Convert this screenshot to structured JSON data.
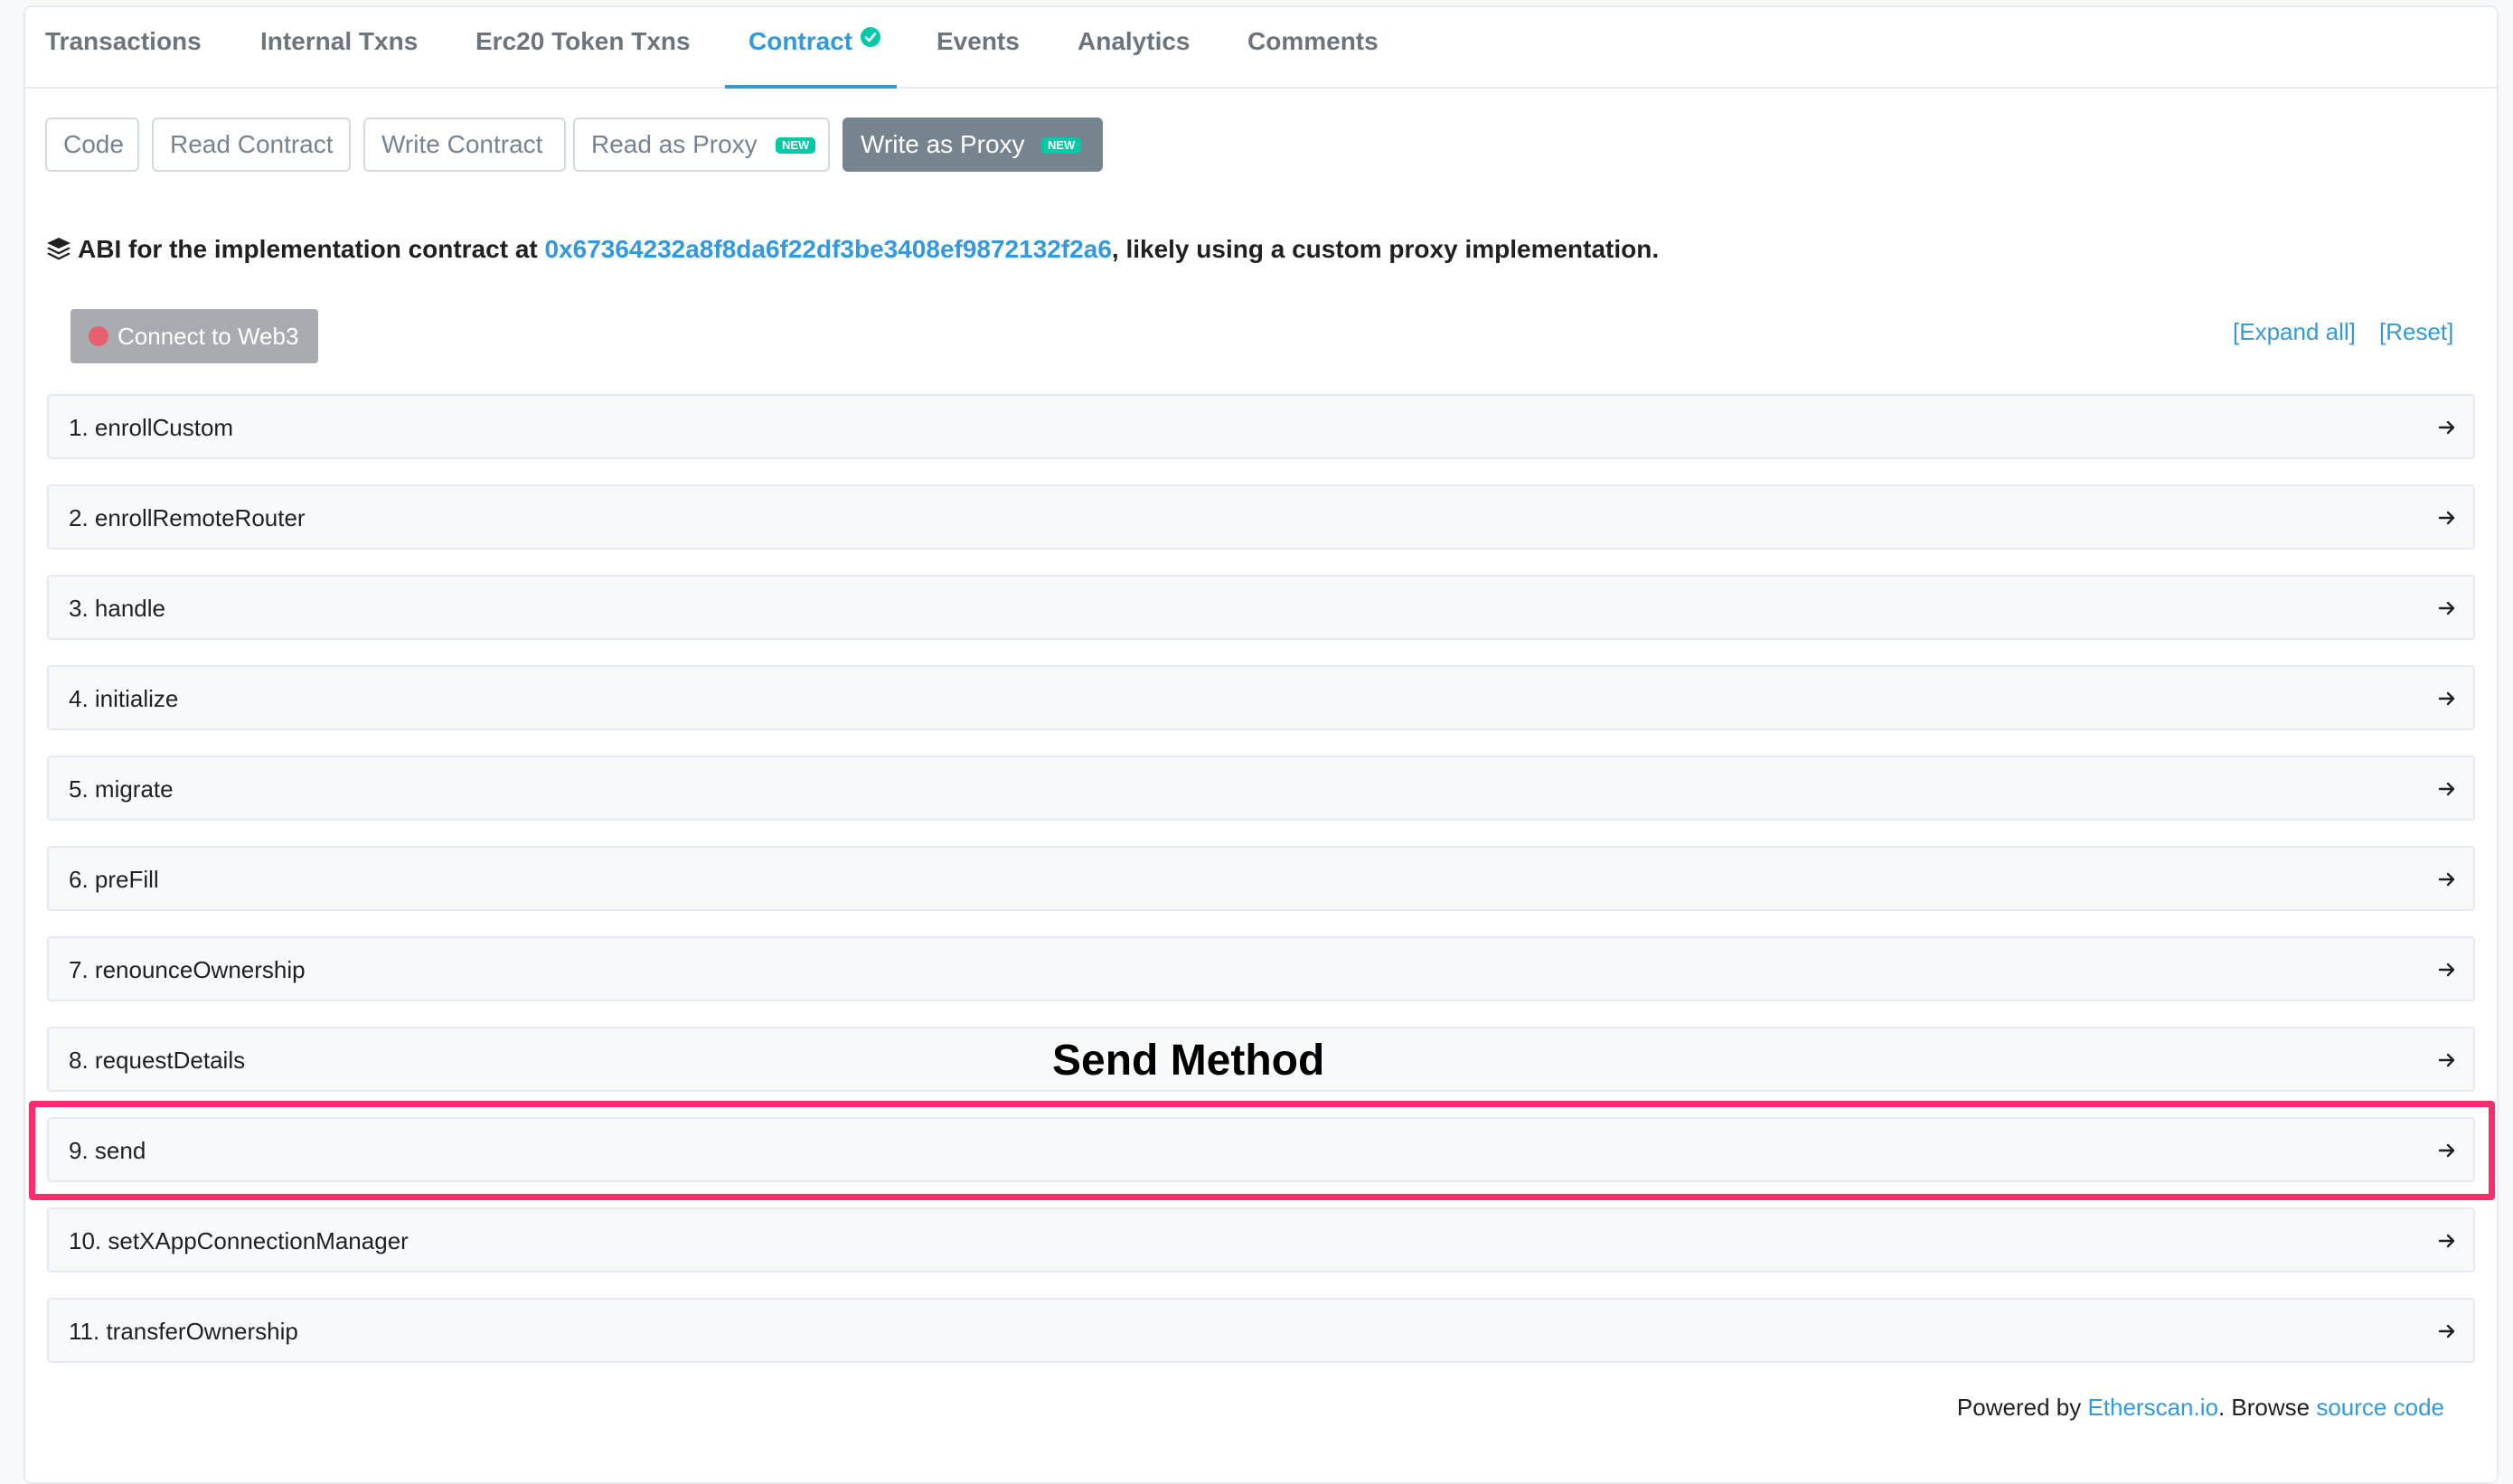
{
  "tabs": [
    {
      "label": "Transactions"
    },
    {
      "label": "Internal Txns"
    },
    {
      "label": "Erc20 Token Txns"
    },
    {
      "label": "Contract"
    },
    {
      "label": "Events"
    },
    {
      "label": "Analytics"
    },
    {
      "label": "Comments"
    }
  ],
  "active_tab": "Contract",
  "subtabs": [
    {
      "label": "Code"
    },
    {
      "label": "Read Contract"
    },
    {
      "label": "Write Contract"
    },
    {
      "label": "Read as Proxy",
      "badge": "NEW"
    },
    {
      "label": "Write as Proxy",
      "badge": "NEW"
    }
  ],
  "active_subtab": "Write as Proxy",
  "abi": {
    "prefix": "ABI for the implementation contract at ",
    "address": "0x67364232a8f8da6f22df3be3408ef9872132f2a6",
    "suffix": ", likely using a custom proxy implementation."
  },
  "connect_button": "Connect to Web3",
  "expand_all": "[Expand all]",
  "reset": "[Reset]",
  "methods": [
    {
      "label": "1. enrollCustom"
    },
    {
      "label": "2. enrollRemoteRouter"
    },
    {
      "label": "3. handle"
    },
    {
      "label": "4. initialize"
    },
    {
      "label": "5. migrate"
    },
    {
      "label": "6. preFill"
    },
    {
      "label": "7. renounceOwnership"
    },
    {
      "label": "8. requestDetails"
    },
    {
      "label": "9. send"
    },
    {
      "label": "10. setXAppConnectionManager"
    },
    {
      "label": "11. transferOwnership"
    }
  ],
  "annotation": "Send Method",
  "footer": {
    "powered_by": "Powered by ",
    "etherscan": "Etherscan.io",
    "browse": ". Browse ",
    "source_code": "source code"
  },
  "colors": {
    "accent": "#3498db",
    "highlight": "#ff2d6b",
    "badge": "#00c9a7"
  }
}
